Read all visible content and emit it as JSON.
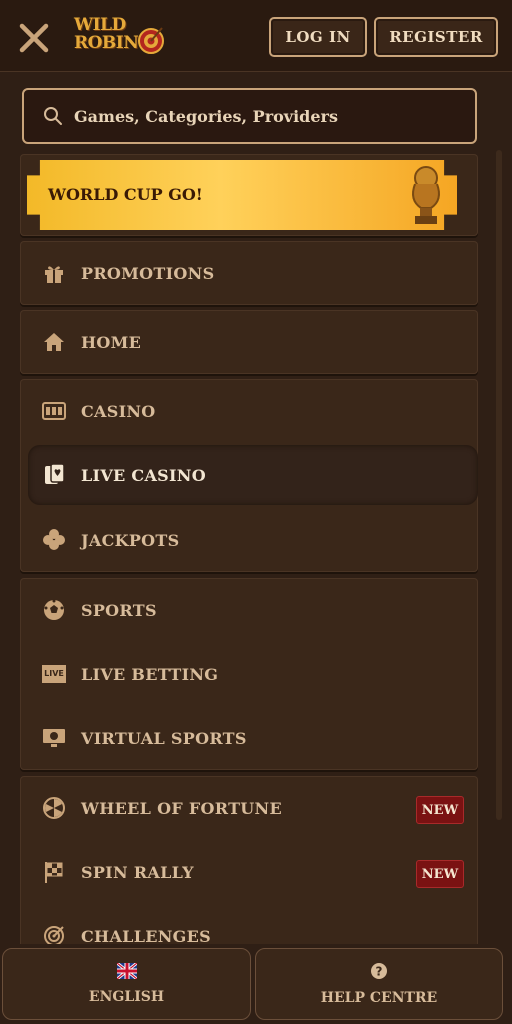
{
  "header": {
    "logo_line1": "WILD",
    "logo_line2": "ROBIN",
    "login_label": "LOG IN",
    "register_label": "REGISTER"
  },
  "search": {
    "placeholder": "Games, Categories, Providers"
  },
  "banner": {
    "label": "WORLD CUP GO!"
  },
  "menu": {
    "promotions": "PROMOTIONS",
    "home": "HOME",
    "casino": "CASINO",
    "live_casino": "LIVE CASINO",
    "jackpots": "JACKPOTS",
    "sports": "SPORTS",
    "live_betting": "LIVE BETTING",
    "virtual_sports": "VIRTUAL SPORTS",
    "wheel_of_fortune": "WHEEL OF FORTUNE",
    "spin_rally": "SPIN RALLY",
    "challenges": "CHALLENGES",
    "new_badge": "NEW",
    "live_icon_text": "LIVE"
  },
  "footer": {
    "language_label": "ENGLISH",
    "help_label": "HELP CENTRE"
  },
  "icons": {
    "close": "close-icon",
    "search": "search-icon",
    "gift": "gift-icon",
    "home": "home-icon",
    "slot_machine": "slot-machine-icon",
    "cards": "playing-cards-icon",
    "clover": "clover-icon",
    "soccer_ball": "soccer-ball-icon",
    "live": "live-icon",
    "monitor": "monitor-icon",
    "wheel": "wheel-icon",
    "flag": "checkered-flag-icon",
    "target": "target-icon",
    "uk_flag": "uk-flag-icon",
    "help": "help-icon",
    "trophy": "trophy-icon"
  },
  "colors": {
    "background": "#2f1f15",
    "panel": "#3a2719",
    "accent_gold": "#f3b928",
    "badge_red": "#7a1212",
    "text": "#d7bb9a"
  }
}
